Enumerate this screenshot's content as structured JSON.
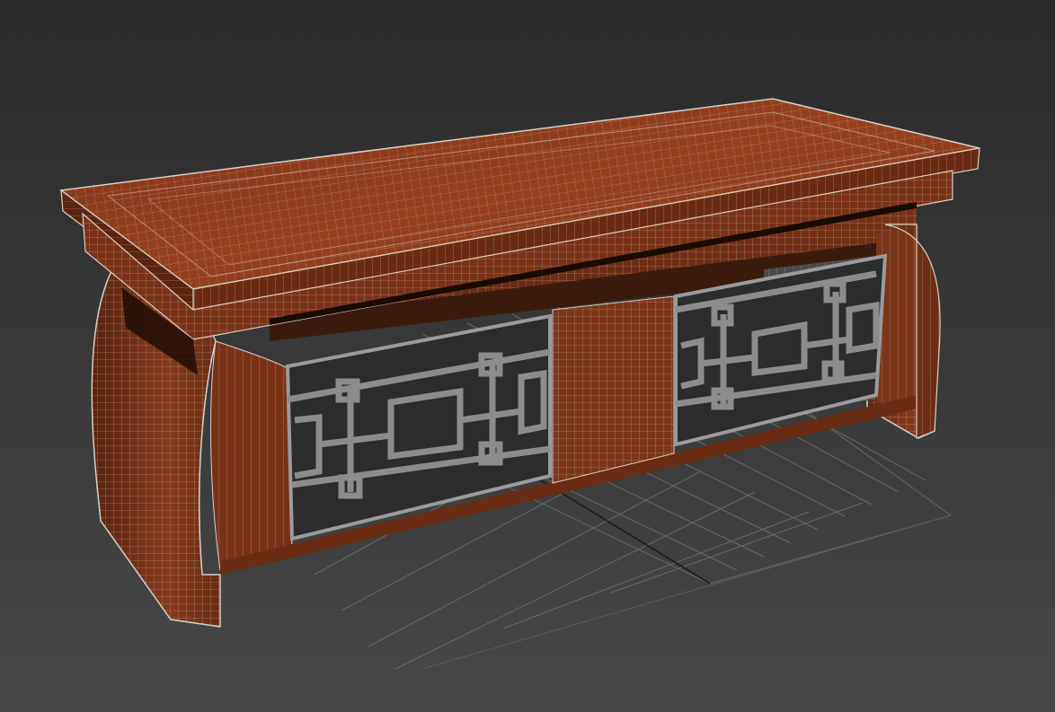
{
  "viewport": {
    "background_top": "#2a2a2a",
    "background_bottom": "#484848"
  },
  "scene": {
    "object": "wooden-bench-wireframe",
    "wood_color": "#8a3a1c",
    "wood_dark": "#5a2410",
    "wood_light": "#a2522a",
    "wireframe_color": "#d8d0c8",
    "grid_color": "#6a6a6a",
    "grid_axis_color": "#1a1a1a",
    "lattice_color": "#8c8c8c"
  }
}
